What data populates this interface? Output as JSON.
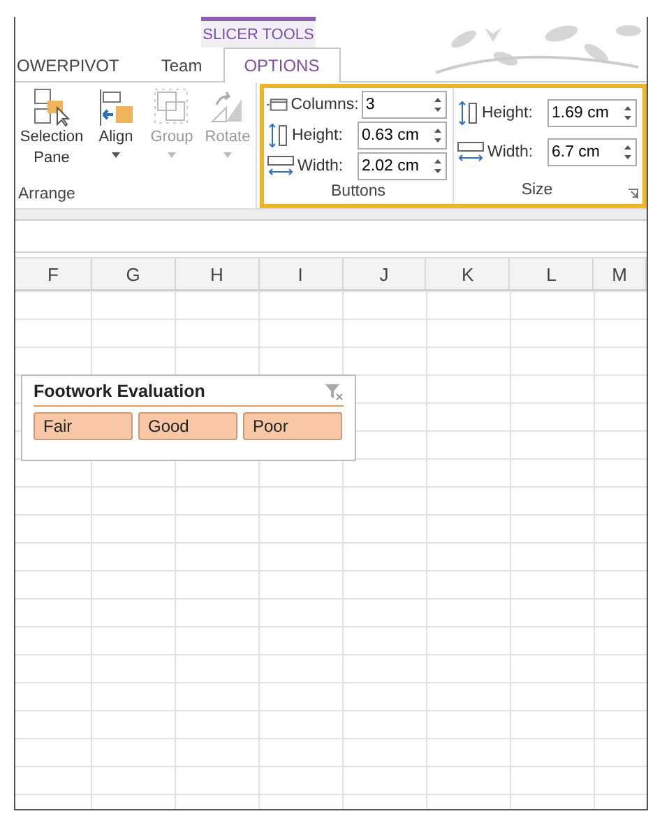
{
  "contextual_tab_group": {
    "title": "SLICER TOOLS"
  },
  "tabs": [
    {
      "label": "OWERPIVOT",
      "selected": false
    },
    {
      "label": "Team",
      "selected": false
    },
    {
      "label": "OPTIONS",
      "selected": true
    }
  ],
  "ribbon": {
    "arrange": {
      "label": "Arrange",
      "buttons": [
        {
          "label": "Selection\nPane",
          "kind": "selection",
          "dropdown": false,
          "disabled": false
        },
        {
          "label": "Align",
          "kind": "align",
          "dropdown": true,
          "disabled": false
        },
        {
          "label": "Group",
          "kind": "group",
          "dropdown": true,
          "disabled": true
        },
        {
          "label": "Rotate",
          "kind": "rotate",
          "dropdown": true,
          "disabled": true
        }
      ]
    },
    "buttons_group": {
      "label": "Buttons",
      "fields": [
        {
          "label": "Columns:",
          "value": "3",
          "kind": "columns"
        },
        {
          "label": "Height:",
          "value": "0.63 cm",
          "kind": "height"
        },
        {
          "label": "Width:",
          "value": "2.02 cm",
          "kind": "width"
        }
      ]
    },
    "size_group": {
      "label": "Size",
      "fields": [
        {
          "label": "Height:",
          "value": "1.69 cm",
          "kind": "height"
        },
        {
          "label": "Width:",
          "value": "6.7 cm",
          "kind": "width"
        }
      ]
    }
  },
  "sheet": {
    "columns": [
      "F",
      "G",
      "H",
      "I",
      "J",
      "K",
      "L",
      "M"
    ]
  },
  "slicer": {
    "title": "Footwork Evaluation",
    "items": [
      {
        "label": "Fair",
        "selected": true
      },
      {
        "label": "Good",
        "selected": true
      },
      {
        "label": "Poor",
        "selected": true
      }
    ]
  }
}
